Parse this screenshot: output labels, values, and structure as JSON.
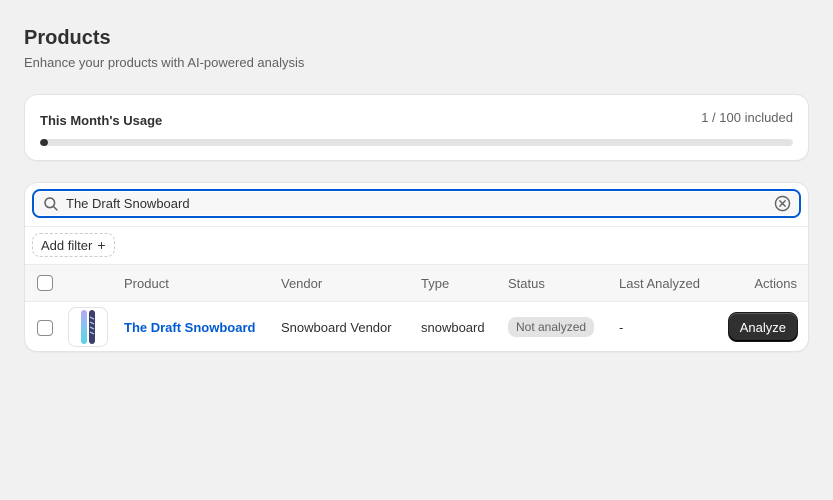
{
  "header": {
    "title": "Products",
    "subtitle": "Enhance your products with AI-powered analysis"
  },
  "usage": {
    "title": "This Month's Usage",
    "count_text": "1 / 100 included",
    "progress_fraction": 0.01
  },
  "search": {
    "value": "The Draft Snowboard"
  },
  "filters": {
    "add_filter_label": "Add filter",
    "add_filter_icon": "+"
  },
  "table": {
    "columns": [
      "Product",
      "Vendor",
      "Type",
      "Status",
      "Last Analyzed",
      "Actions"
    ],
    "rows": [
      {
        "product": "The Draft Snowboard",
        "vendor": "Snowboard Vendor",
        "type": "snowboard",
        "status": "Not analyzed",
        "last_analyzed": "-",
        "action_label": "Analyze"
      }
    ]
  },
  "colors": {
    "accent": "#005bd3",
    "primary_button": "#303030",
    "background": "#f1f1f1"
  }
}
